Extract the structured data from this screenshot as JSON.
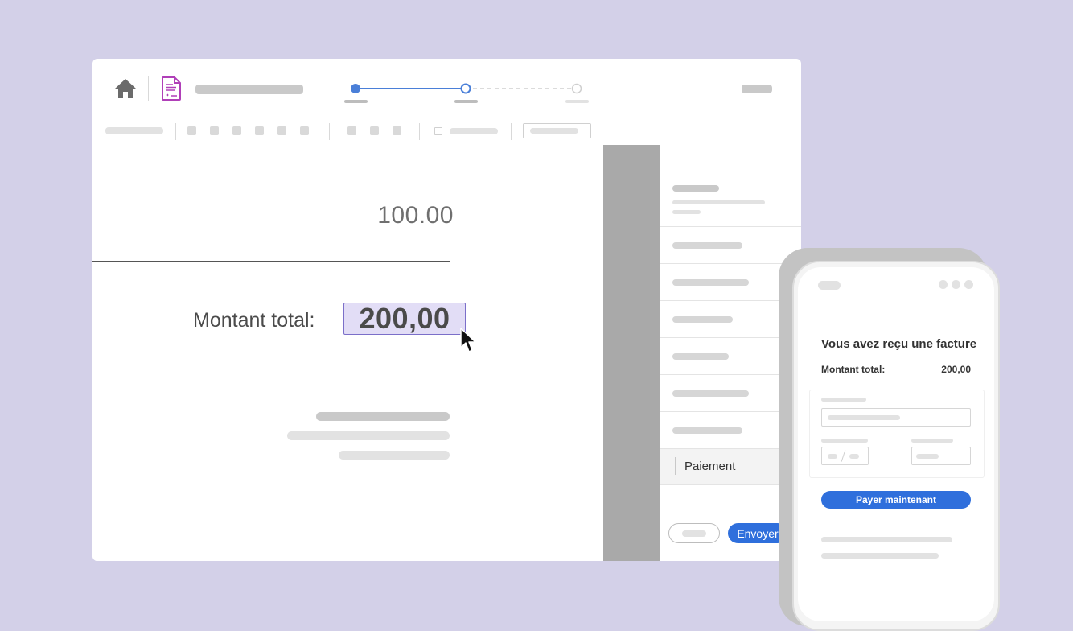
{
  "document": {
    "amount_line": "100.00",
    "total_label": "Montant total:",
    "total_value": "200,00"
  },
  "steps": {
    "total": 3,
    "completed": 1,
    "current": 2
  },
  "panel": {
    "payment_field": "Paiement",
    "send_button": "Envoyer"
  },
  "phone": {
    "title": "Vous avez reçu une facture",
    "total_label": "Montant total:",
    "total_value": "200,00",
    "pay_button": "Payer maintenant"
  },
  "colors": {
    "background": "#d3d0e8",
    "accent": "#2f6fdc",
    "highlight_fill": "#e2ddf6",
    "highlight_border": "#7b6fc9",
    "doc_icon": "#b03fb8"
  },
  "icons": [
    "home-icon",
    "document-signature-icon",
    "mouse-pointer-icon"
  ]
}
